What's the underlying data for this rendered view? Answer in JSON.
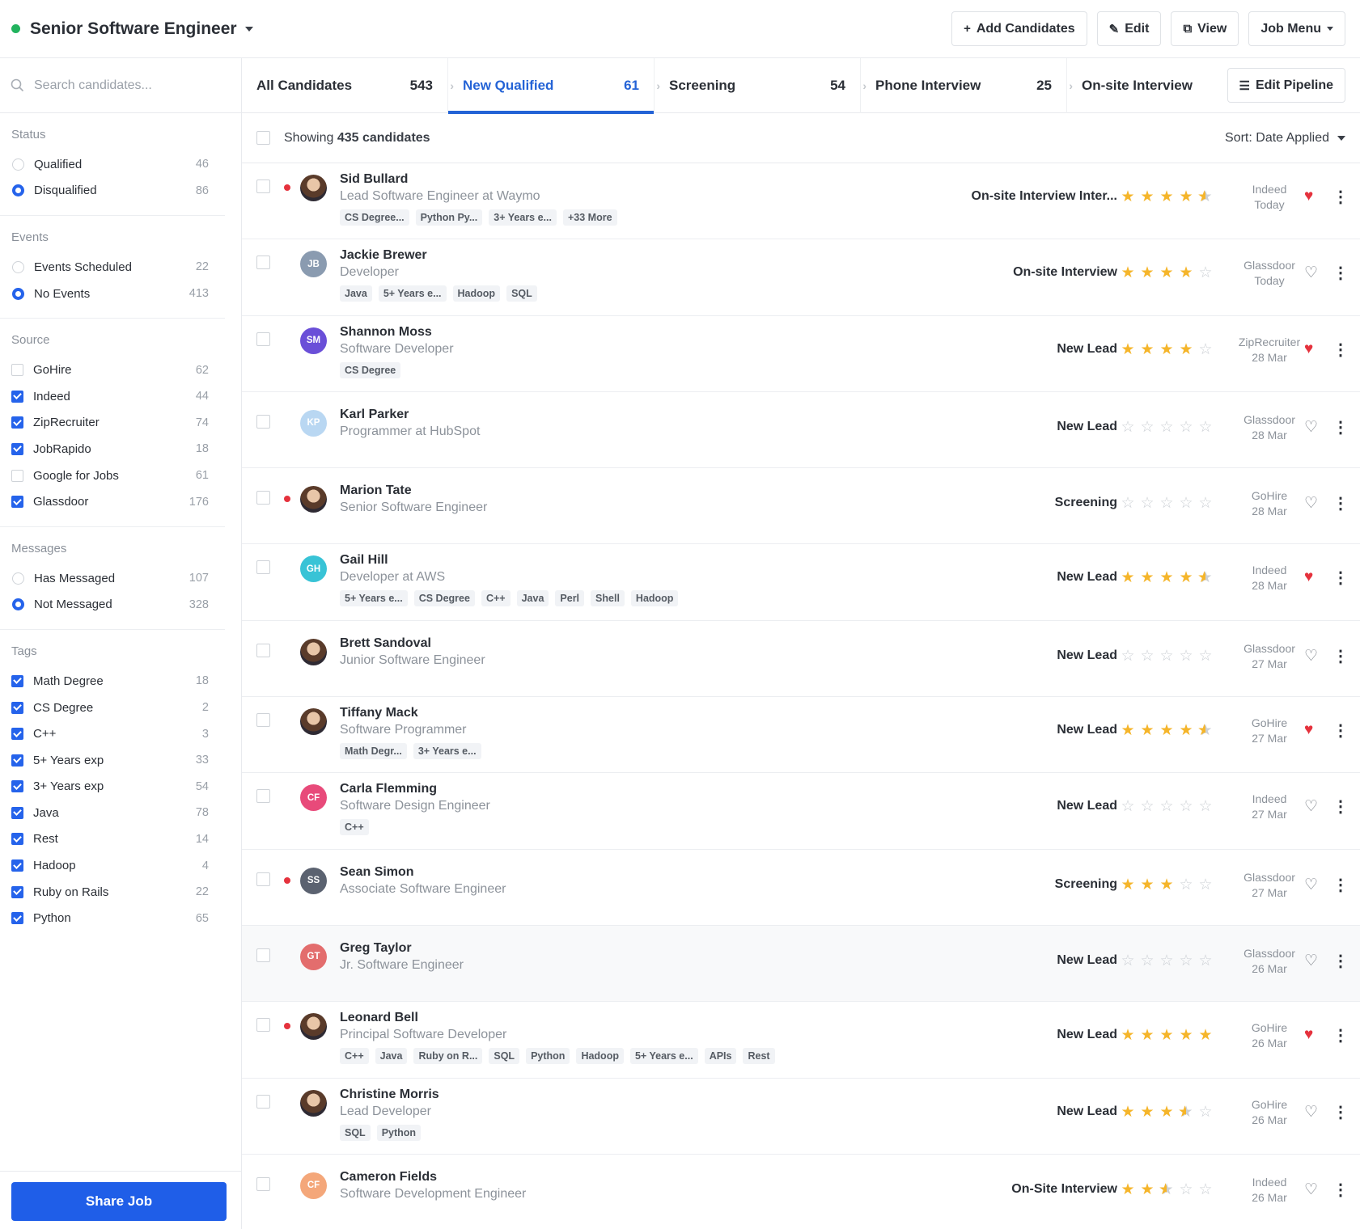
{
  "header": {
    "job_title": "Senior Software Engineer",
    "status_color": "#22b35e",
    "buttons": {
      "add_candidates": "Add Candidates",
      "edit": "Edit",
      "view": "View",
      "job_menu": "Job Menu"
    }
  },
  "search": {
    "placeholder": "Search candidates..."
  },
  "filters": {
    "status": {
      "title": "Status",
      "options": [
        {
          "label": "Qualified",
          "count": "46",
          "selected": false
        },
        {
          "label": "Disqualified",
          "count": "86",
          "selected": true
        }
      ]
    },
    "events": {
      "title": "Events",
      "options": [
        {
          "label": "Events Scheduled",
          "count": "22",
          "selected": false
        },
        {
          "label": "No Events",
          "count": "413",
          "selected": true
        }
      ]
    },
    "source": {
      "title": "Source",
      "options": [
        {
          "label": "GoHire",
          "count": "62",
          "checked": false
        },
        {
          "label": "Indeed",
          "count": "44",
          "checked": true
        },
        {
          "label": "ZipRecruiter",
          "count": "74",
          "checked": true
        },
        {
          "label": "JobRapido",
          "count": "18",
          "checked": true
        },
        {
          "label": "Google for Jobs",
          "count": "61",
          "checked": false
        },
        {
          "label": "Glassdoor",
          "count": "176",
          "checked": true
        }
      ]
    },
    "messages": {
      "title": "Messages",
      "options": [
        {
          "label": "Has Messaged",
          "count": "107",
          "selected": false
        },
        {
          "label": "Not Messaged",
          "count": "328",
          "selected": true
        }
      ]
    },
    "tags": {
      "title": "Tags",
      "options": [
        {
          "label": "Math Degree",
          "count": "18",
          "checked": true
        },
        {
          "label": "CS Degree",
          "count": "2",
          "checked": true
        },
        {
          "label": "C++",
          "count": "3",
          "checked": true
        },
        {
          "label": "5+ Years exp",
          "count": "33",
          "checked": true
        },
        {
          "label": "3+ Years exp",
          "count": "54",
          "checked": true
        },
        {
          "label": "Java",
          "count": "78",
          "checked": true
        },
        {
          "label": "Rest",
          "count": "14",
          "checked": true
        },
        {
          "label": "Hadoop",
          "count": "4",
          "checked": true
        },
        {
          "label": "Ruby on Rails",
          "count": "22",
          "checked": true
        },
        {
          "label": "Python",
          "count": "65",
          "checked": true
        }
      ]
    }
  },
  "share_job": "Share Job",
  "pipeline": {
    "tabs": [
      {
        "label": "All Candidates",
        "count": "543",
        "active": false
      },
      {
        "label": "New Qualified",
        "count": "61",
        "active": true
      },
      {
        "label": "Screening",
        "count": "54",
        "active": false
      },
      {
        "label": "Phone Interview",
        "count": "25",
        "active": false
      },
      {
        "label": "On-site Interview",
        "count": "",
        "active": false
      }
    ],
    "edit_pipeline": "Edit Pipeline",
    "accent": "#2463d6"
  },
  "list": {
    "showing_prefix": "Showing",
    "showing_count": "435",
    "showing_suffix": "candidates",
    "sort_label": "Sort: Date Applied"
  },
  "candidates": [
    {
      "name": "Sid Bullard",
      "title": "Lead Software Engineer at Waymo",
      "tags": [
        "CS Degree...",
        "Python Py...",
        "3+ Years e...",
        "+33 More"
      ],
      "stage": "On-site Interview Inter...",
      "rating": 4.5,
      "source": "Indeed",
      "date": "Today",
      "favorite": true,
      "unread": true,
      "avatar": {
        "type": "photo",
        "initials": ""
      }
    },
    {
      "name": "Jackie Brewer",
      "title": "Developer",
      "tags": [
        "Java",
        "5+ Years e...",
        "Hadoop",
        "SQL"
      ],
      "stage": "On-site Interview",
      "rating": 4,
      "source": "Glassdoor",
      "date": "Today",
      "favorite": false,
      "unread": false,
      "avatar": {
        "type": "initials",
        "initials": "JB",
        "color": "#8a9bb0"
      }
    },
    {
      "name": "Shannon Moss",
      "title": "Software Developer",
      "tags": [
        "CS Degree"
      ],
      "stage": "New Lead",
      "rating": 4,
      "source": "ZipRecruiter",
      "date": "28 Mar",
      "favorite": true,
      "unread": false,
      "avatar": {
        "type": "initials",
        "initials": "SM",
        "color": "#6a4fd8"
      }
    },
    {
      "name": "Karl Parker",
      "title": "Programmer at HubSpot",
      "tags": [],
      "stage": "New Lead",
      "rating": 0,
      "source": "Glassdoor",
      "date": "28 Mar",
      "favorite": false,
      "unread": false,
      "avatar": {
        "type": "initials",
        "initials": "KP",
        "color": "#b9d7f2"
      }
    },
    {
      "name": "Marion Tate",
      "title": "Senior Software Engineer",
      "tags": [],
      "stage": "Screening",
      "rating": 0,
      "source": "GoHire",
      "date": "28 Mar",
      "favorite": false,
      "unread": true,
      "avatar": {
        "type": "photo",
        "initials": ""
      }
    },
    {
      "name": "Gail Hill",
      "title": "Developer at AWS",
      "tags": [
        "5+ Years e...",
        "CS Degree",
        "C++",
        "Java",
        "Perl",
        "Shell",
        "Hadoop"
      ],
      "stage": "New Lead",
      "rating": 4.5,
      "source": "Indeed",
      "date": "28 Mar",
      "favorite": true,
      "unread": false,
      "avatar": {
        "type": "initials",
        "initials": "GH",
        "color": "#38c3d6"
      }
    },
    {
      "name": "Brett Sandoval",
      "title": "Junior Software Engineer",
      "tags": [],
      "stage": "New Lead",
      "rating": 0,
      "source": "Glassdoor",
      "date": "27 Mar",
      "favorite": false,
      "unread": false,
      "avatar": {
        "type": "photo",
        "initials": ""
      }
    },
    {
      "name": "Tiffany Mack",
      "title": "Software Programmer",
      "tags": [
        "Math Degr...",
        "3+ Years e..."
      ],
      "stage": "New Lead",
      "rating": 4.5,
      "source": "GoHire",
      "date": "27 Mar",
      "favorite": true,
      "unread": false,
      "avatar": {
        "type": "photo",
        "initials": ""
      }
    },
    {
      "name": "Carla Flemming",
      "title": "Software Design Engineer",
      "tags": [
        "C++"
      ],
      "stage": "New Lead",
      "rating": 0,
      "source": "Indeed",
      "date": "27 Mar",
      "favorite": false,
      "unread": false,
      "avatar": {
        "type": "initials",
        "initials": "CF",
        "color": "#e84a7a"
      }
    },
    {
      "name": "Sean Simon",
      "title": "Associate Software Engineer",
      "tags": [],
      "stage": "Screening",
      "rating": 3,
      "source": "Glassdoor",
      "date": "27 Mar",
      "favorite": false,
      "unread": true,
      "avatar": {
        "type": "initials",
        "initials": "SS",
        "color": "#5b6270"
      }
    },
    {
      "name": "Greg Taylor",
      "title": "Jr. Software Engineer",
      "tags": [],
      "stage": "New Lead",
      "rating": 0,
      "source": "Glassdoor",
      "date": "26 Mar",
      "favorite": false,
      "unread": false,
      "hover": true,
      "avatar": {
        "type": "initials",
        "initials": "GT",
        "color": "#e36d6d"
      }
    },
    {
      "name": "Leonard Bell",
      "title": "Principal Software Developer",
      "tags": [
        "C++",
        "Java",
        "Ruby on R...",
        "SQL",
        "Python",
        "Hadoop",
        "5+ Years e...",
        "APIs",
        "Rest"
      ],
      "stage": "New Lead",
      "rating": 5,
      "source": "GoHire",
      "date": "26 Mar",
      "favorite": true,
      "unread": true,
      "avatar": {
        "type": "photo",
        "initials": ""
      }
    },
    {
      "name": "Christine Morris",
      "title": "Lead Developer",
      "tags": [
        "SQL",
        "Python"
      ],
      "stage": "New Lead",
      "rating": 3.5,
      "source": "GoHire",
      "date": "26 Mar",
      "favorite": false,
      "unread": false,
      "avatar": {
        "type": "photo",
        "initials": ""
      }
    },
    {
      "name": "Cameron Fields",
      "title": "Software Development Engineer",
      "tags": [],
      "stage": "On-Site Interview",
      "rating": 2.5,
      "source": "Indeed",
      "date": "26 Mar",
      "favorite": false,
      "unread": false,
      "avatar": {
        "type": "initials",
        "initials": "CF",
        "color": "#f4a77a"
      }
    }
  ]
}
